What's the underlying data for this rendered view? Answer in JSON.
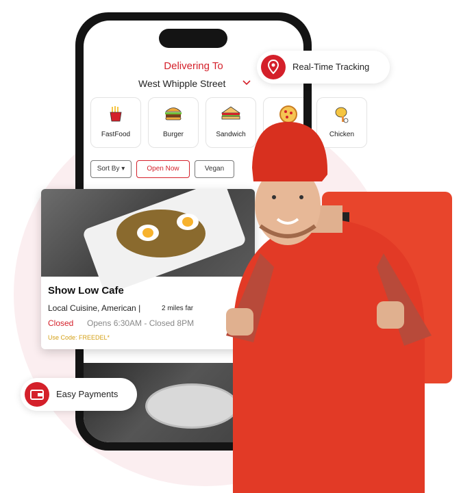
{
  "header": {
    "delivering_to": "Delivering To",
    "address": "West Whipple Street"
  },
  "categories": [
    {
      "label": "FastFood",
      "icon": "fries-icon"
    },
    {
      "label": "Burger",
      "icon": "burger-icon"
    },
    {
      "label": "Sandwich",
      "icon": "sandwich-icon"
    },
    {
      "label": "",
      "icon": "pizza-icon"
    },
    {
      "label": "Chicken",
      "icon": "chicken-icon"
    }
  ],
  "filters": {
    "sort_by": "Sort By",
    "open_now": "Open Now",
    "vegan": "Vegan"
  },
  "restaurant": {
    "name": "Show Low Cafe",
    "cuisine": "Local Cuisine, American |",
    "distance": "2 miles far",
    "status": "Closed",
    "hours": "Opens 6:30AM - Closed 8PM",
    "code": "Use Code: FREEDEL*"
  },
  "badges": {
    "tracking": "Real-Time Tracking",
    "payments": "Easy Payments"
  },
  "colors": {
    "accent": "#d4202a",
    "code": "#d4a017"
  }
}
